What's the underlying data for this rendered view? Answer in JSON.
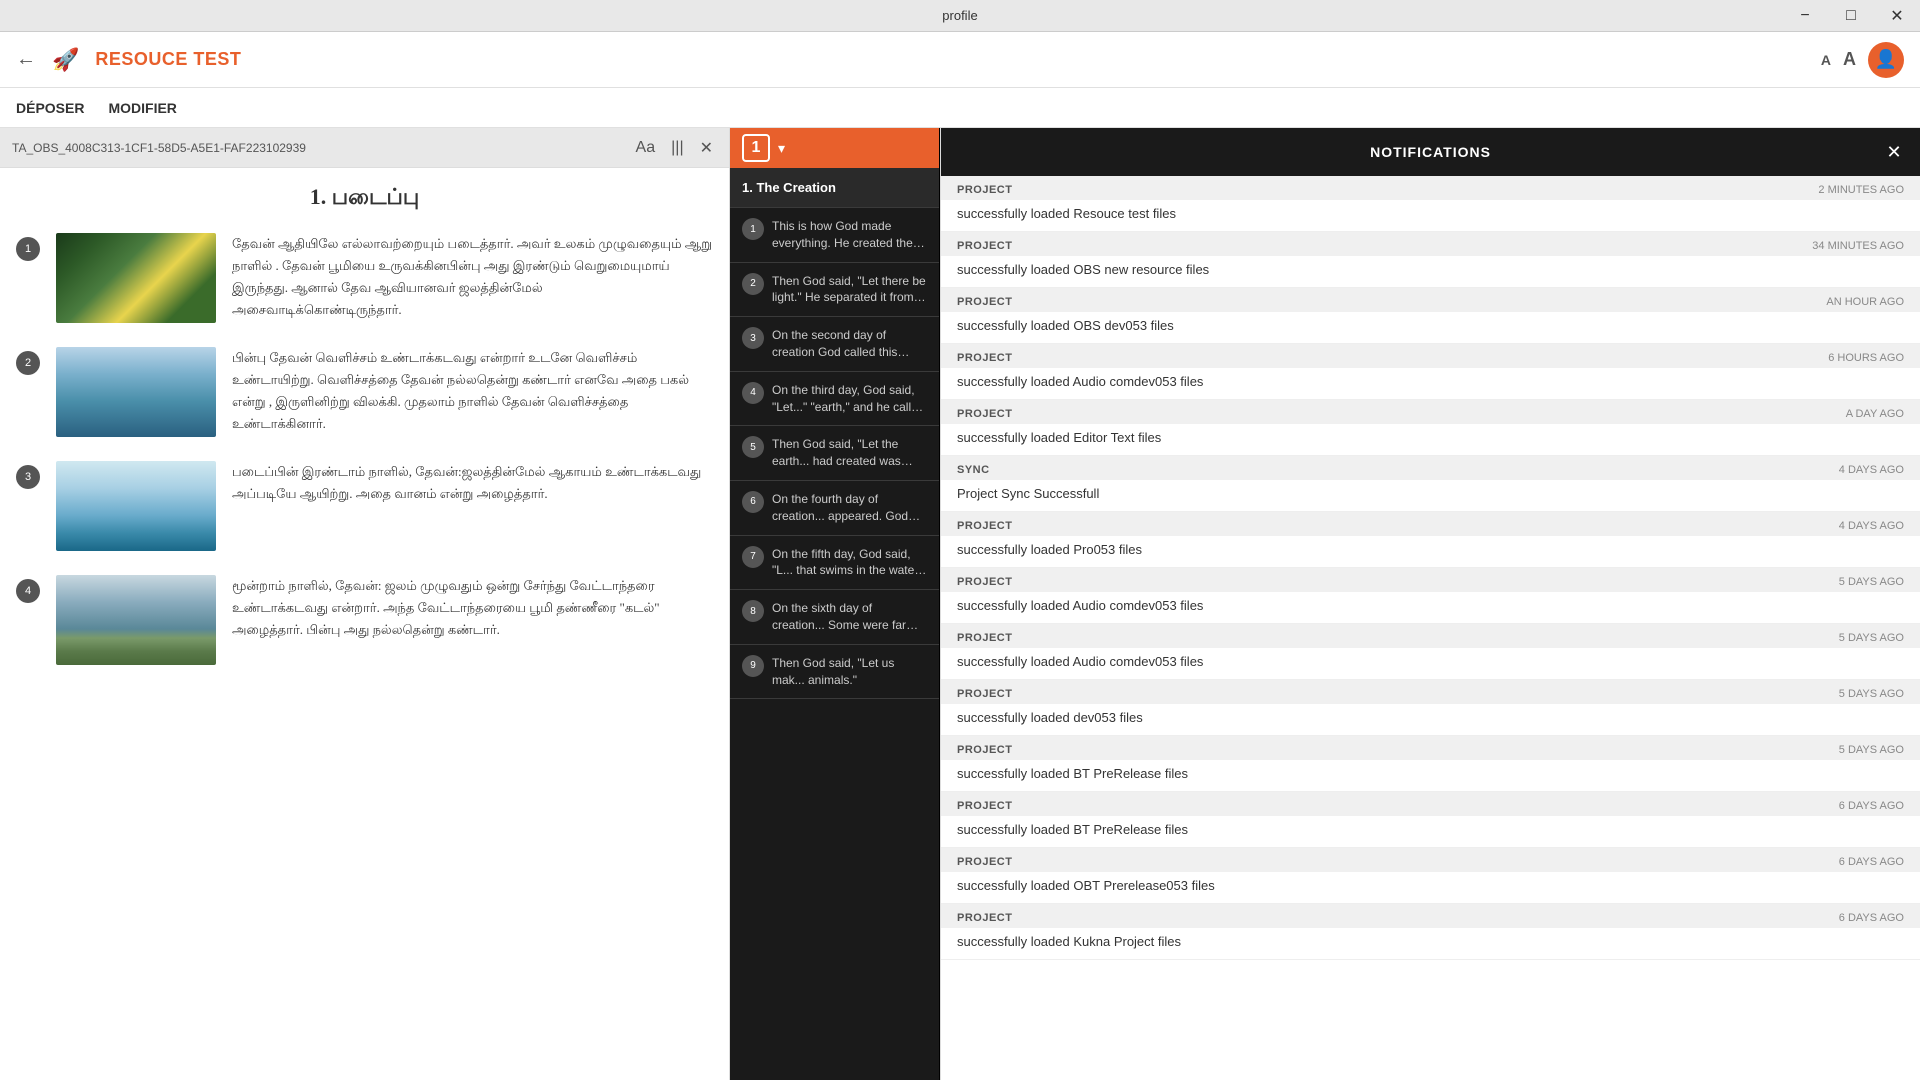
{
  "titleBar": {
    "title": "profile",
    "minimize": "−",
    "maximize": "□",
    "close": "✕"
  },
  "header": {
    "backIcon": "←",
    "rocketIcon": "🚀",
    "appTitle": "RESOUCE TEST",
    "fontSizeSmall": "A",
    "fontSizeLarge": "A",
    "avatarIcon": "👤"
  },
  "nav": {
    "items": [
      "DÉPOSER",
      "MODIFIER"
    ]
  },
  "leftPanel": {
    "toolbarLabel": "TA_OBS_4008C313-1CF1-58D5-A5E1-FAF223102939",
    "fontIcon": "Aa",
    "columnsIcon": "|||",
    "closeIcon": "✕",
    "chapterTitle": "1. படைப்பு",
    "verses": [
      {
        "num": "1",
        "imgClass": "img1",
        "text": "தேவன் ஆதியிலே எல்லாவற்றையும் படைத்தார். அவர் உலகம் முழுவதையும் ஆறு நாளில் . தேவன் பூமியை உருவக்கினபின்பு அது இரண்டும் வெறுமையுமாய் இருந்தது. ஆனால் தேவ ஆவியானவர் ஜலத்தின்மேல் அசைவாடிக்கொண்டிருந்தார்."
      },
      {
        "num": "2",
        "imgClass": "img2",
        "text": "பின்பு தேவன் வெளிச்சம் உண்டாக்கடவது என்றார் உடனே வெளிச்சம் உண்டாயிற்று. வெளிச்சத்தை தேவன் நல்லதென்று கண்டார் எனவே அதை பகல் என்று , இருளினிற்று விலக்கி. முதலாம் நாளில் தேவன் வெளிச்சத்தை உண்டாக்கினார்."
      },
      {
        "num": "3",
        "imgClass": "img3",
        "text": "படைப்பின் இரண்டாம் நாளில், தேவன்:ஜலத்தின்மேல் ஆகாயம் உண்டாக்கடவது அப்படியே ஆயிற்று. அதை வானம் என்று அழைத்தார்."
      },
      {
        "num": "4",
        "imgClass": "img4",
        "text": "மூன்றாம் நாளில், தேவன்: ஜலம் முழுவதும் ஒன்று சேர்ந்து வேட்டாந்தரை உண்டாக்கடவது என்றார். அந்த வேட்டாந்தரையை பூமி தண்ணீரை \"கடல்\" அழைத்தார். பின்பு அது நல்லதென்று கண்டார்."
      }
    ]
  },
  "middlePanel": {
    "chapterNum": "1",
    "chapterHeading": "1. The Creation",
    "verses": [
      {
        "num": "1",
        "text": "This is how God made everything. He created the earth it was dark ..."
      },
      {
        "num": "2",
        "text": "Then God said, \"Let there be light.\" He separated it from the darkness..."
      },
      {
        "num": "3",
        "text": "On the second day of creation God called this expanse \"sky.\""
      },
      {
        "num": "4",
        "text": "On the third day, God said, \"Let...\" \"earth,\" and he called the wat..."
      },
      {
        "num": "5",
        "text": "Then God said, \"Let the earth... had created was good."
      },
      {
        "num": "6",
        "text": "On the fourth day of creation... appeared. God made them t... what he had created was go..."
      },
      {
        "num": "7",
        "text": "On the fifth day, God said, \"L... that swims in the water and al..."
      },
      {
        "num": "8",
        "text": "On the sixth day of creation... Some were farm animals, som..."
      },
      {
        "num": "9",
        "text": "Then God said, \"Let us mak... animals.\""
      }
    ]
  },
  "notifications": {
    "title": "NOTIFICATIONS",
    "closeIcon": "✕",
    "items": [
      {
        "type": "PROJECT",
        "time": "2 MINUTES AGO",
        "message": "successfully loaded Resouce test files"
      },
      {
        "type": "PROJECT",
        "time": "34 MINUTES AGO",
        "message": "successfully loaded OBS new resource files"
      },
      {
        "type": "PROJECT",
        "time": "AN HOUR AGO",
        "message": "successfully loaded OBS dev053 files"
      },
      {
        "type": "PROJECT",
        "time": "6 HOURS AGO",
        "message": "successfully loaded Audio comdev053 files"
      },
      {
        "type": "PROJECT",
        "time": "A DAY AGO",
        "message": "successfully loaded Editor Text files"
      },
      {
        "type": "SYNC",
        "time": "4 DAYS AGO",
        "message": "Project Sync Successfull"
      },
      {
        "type": "PROJECT",
        "time": "4 DAYS AGO",
        "message": "successfully loaded Pro053 files"
      },
      {
        "type": "PROJECT",
        "time": "5 DAYS AGO",
        "message": "successfully loaded Audio comdev053 files"
      },
      {
        "type": "PROJECT",
        "time": "5 DAYS AGO",
        "message": "successfully loaded Audio comdev053 files"
      },
      {
        "type": "PROJECT",
        "time": "5 DAYS AGO",
        "message": "successfully loaded dev053 files"
      },
      {
        "type": "PROJECT",
        "time": "5 DAYS AGO",
        "message": "successfully loaded BT PreRelease files"
      },
      {
        "type": "PROJECT",
        "time": "6 DAYS AGO",
        "message": "successfully loaded BT PreRelease files"
      },
      {
        "type": "PROJECT",
        "time": "6 DAYS AGO",
        "message": "successfully loaded OBT Prerelease053 files"
      },
      {
        "type": "PROJECT",
        "time": "6 DAYS AGO",
        "message": "successfully loaded Kukna Project files"
      }
    ]
  }
}
